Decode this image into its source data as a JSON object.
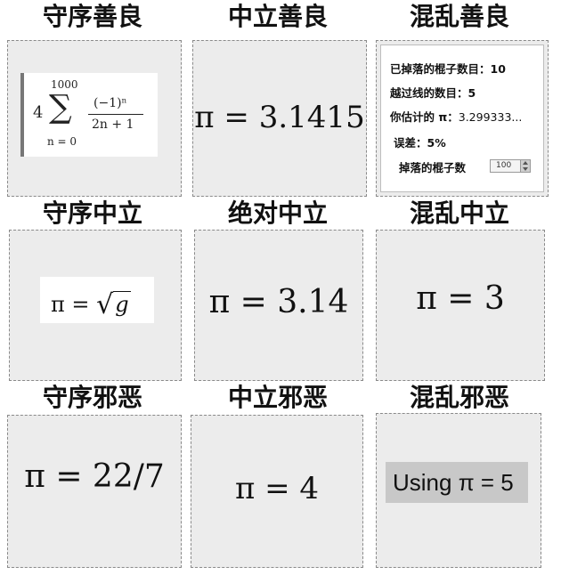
{
  "headings": {
    "lawful_good": "守序善良",
    "neutral_good": "中立善良",
    "chaotic_good": "混乱善良",
    "lawful_neutral": "守序中立",
    "true_neutral": "绝对中立",
    "chaotic_neutral": "混乱中立",
    "lawful_evil": "守序邪恶",
    "neutral_evil": "中立邪恶",
    "chaotic_evil": "混乱邪恶"
  },
  "cells": {
    "lawful_good": {
      "coefficient": "4",
      "upper_limit": "1000",
      "lower_limit": "n = 0",
      "numerator": "(−1)ⁿ",
      "denominator": "2n + 1",
      "sigma": "∑"
    },
    "neutral_good": {
      "formula": "π = 3.1415"
    },
    "chaotic_good": {
      "dropped_label": "已掉落的棍子数目：",
      "dropped_value": "10",
      "crossed_label": "越过线的数目：",
      "crossed_value": "5",
      "estimate_label": "你估计的 π：",
      "estimate_value": "3.299333...",
      "error_label": "误差：",
      "error_value": "5%",
      "drop_count_label": "掉落的棍子数",
      "drop_count_value": "100"
    },
    "lawful_neutral": {
      "lhs": "π = ",
      "radical": "√",
      "radicand": "g"
    },
    "true_neutral": {
      "formula": "π = 3.14"
    },
    "chaotic_neutral": {
      "formula": "π = 3"
    },
    "lawful_evil": {
      "formula": "π = 22/7"
    },
    "neutral_evil": {
      "formula": "π = 4"
    },
    "chaotic_evil": {
      "formula": "Using π = 5"
    }
  }
}
